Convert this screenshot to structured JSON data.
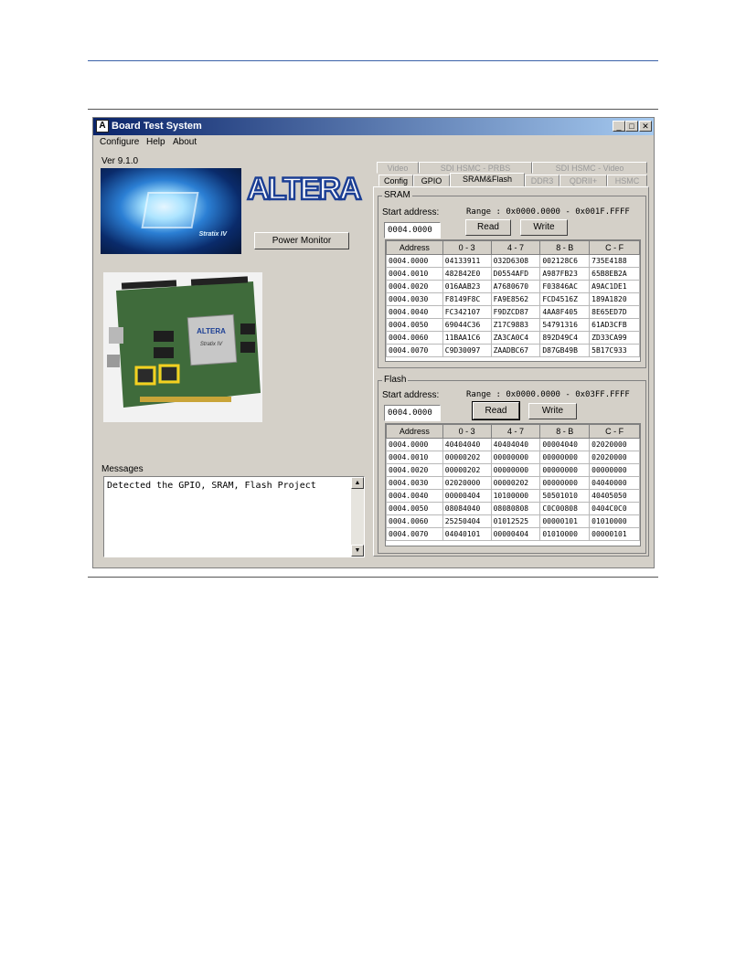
{
  "window": {
    "title": "Board Test System",
    "icon_label": "A",
    "controls": {
      "minimize": "_",
      "maximize": "□",
      "close": "✕"
    }
  },
  "menu": [
    "Configure",
    "Help",
    "About"
  ],
  "version": "Ver 9.1.0",
  "chip_image_label": "Stratix IV",
  "logo_text": "ALTERA",
  "power_monitor_button": "Power Monitor",
  "board_image": {
    "chip_label": "ALTERA",
    "chip_sublabel": "Stratix IV"
  },
  "tabs": {
    "row_back": [
      {
        "label": "Video",
        "enabled": false
      },
      {
        "label": "SDI HSMC - PRBS",
        "enabled": false
      },
      {
        "label": "SDI HSMC - Video",
        "enabled": false
      }
    ],
    "row_front": [
      {
        "label": "Config",
        "enabled": true
      },
      {
        "label": "GPIO",
        "enabled": true
      },
      {
        "label": "SRAM&Flash",
        "enabled": true,
        "active": true
      },
      {
        "label": "DDR3",
        "enabled": false
      },
      {
        "label": "QDRII+",
        "enabled": false
      },
      {
        "label": "HSMC",
        "enabled": false
      }
    ]
  },
  "sram": {
    "title": "SRAM",
    "start_label": "Start address:",
    "range": "Range : 0x0000.0000 - 0x001F.FFFF",
    "start_value": "0004.0000",
    "read_label": "Read",
    "write_label": "Write",
    "columns": [
      "Address",
      "0 - 3",
      "4 - 7",
      "8 - B",
      "C - F"
    ],
    "rows": [
      [
        "0004.0000",
        "04133911",
        "032D6308",
        "002128C6",
        "735E4188"
      ],
      [
        "0004.0010",
        "482842E0",
        "D0554AFD",
        "A987FB23",
        "65B8EB2A"
      ],
      [
        "0004.0020",
        "016AAB23",
        "A7680670",
        "F03846AC",
        "A9AC1DE1"
      ],
      [
        "0004.0030",
        "F8149F8C",
        "FA9E8562",
        "FCD4516Z",
        "189A1820"
      ],
      [
        "0004.0040",
        "FC342107",
        "F9DZCD87",
        "4AA8F405",
        "8E65ED7D"
      ],
      [
        "0004.0050",
        "69044C36",
        "Z17C9883",
        "54791316",
        "61AD3CFB"
      ],
      [
        "0004.0060",
        "11BAA1C6",
        "ZA3CA0C4",
        "892D49C4",
        "ZD33CA99"
      ],
      [
        "0004.0070",
        "C9D30097",
        "ZAADBC67",
        "D87GB49B",
        "5B17C933"
      ]
    ]
  },
  "flash": {
    "title": "Flash",
    "start_label": "Start address:",
    "range": "Range : 0x0000.0000 - 0x03FF.FFFF",
    "start_value": "0004.0000",
    "read_label": "Read",
    "write_label": "Write",
    "columns": [
      "Address",
      "0 - 3",
      "4 - 7",
      "8 - B",
      "C - F"
    ],
    "rows": [
      [
        "0004.0000",
        "40404040",
        "40404040",
        "00004040",
        "02020000"
      ],
      [
        "0004.0010",
        "00000202",
        "00000000",
        "00000000",
        "02020000"
      ],
      [
        "0004.0020",
        "00000202",
        "00000000",
        "00000000",
        "00000000"
      ],
      [
        "0004.0030",
        "02020000",
        "00000202",
        "00000000",
        "04040000"
      ],
      [
        "0004.0040",
        "00000404",
        "10100000",
        "50501010",
        "40405050"
      ],
      [
        "0004.0050",
        "08084040",
        "08080808",
        "C0C00808",
        "0404C0C0"
      ],
      [
        "0004.0060",
        "25250404",
        "01012525",
        "00000101",
        "01010000"
      ],
      [
        "0004.0070",
        "04040101",
        "00000404",
        "01010000",
        "00000101"
      ]
    ]
  },
  "messages": {
    "label": "Messages",
    "text": "Detected the GPIO, SRAM, Flash Project"
  }
}
